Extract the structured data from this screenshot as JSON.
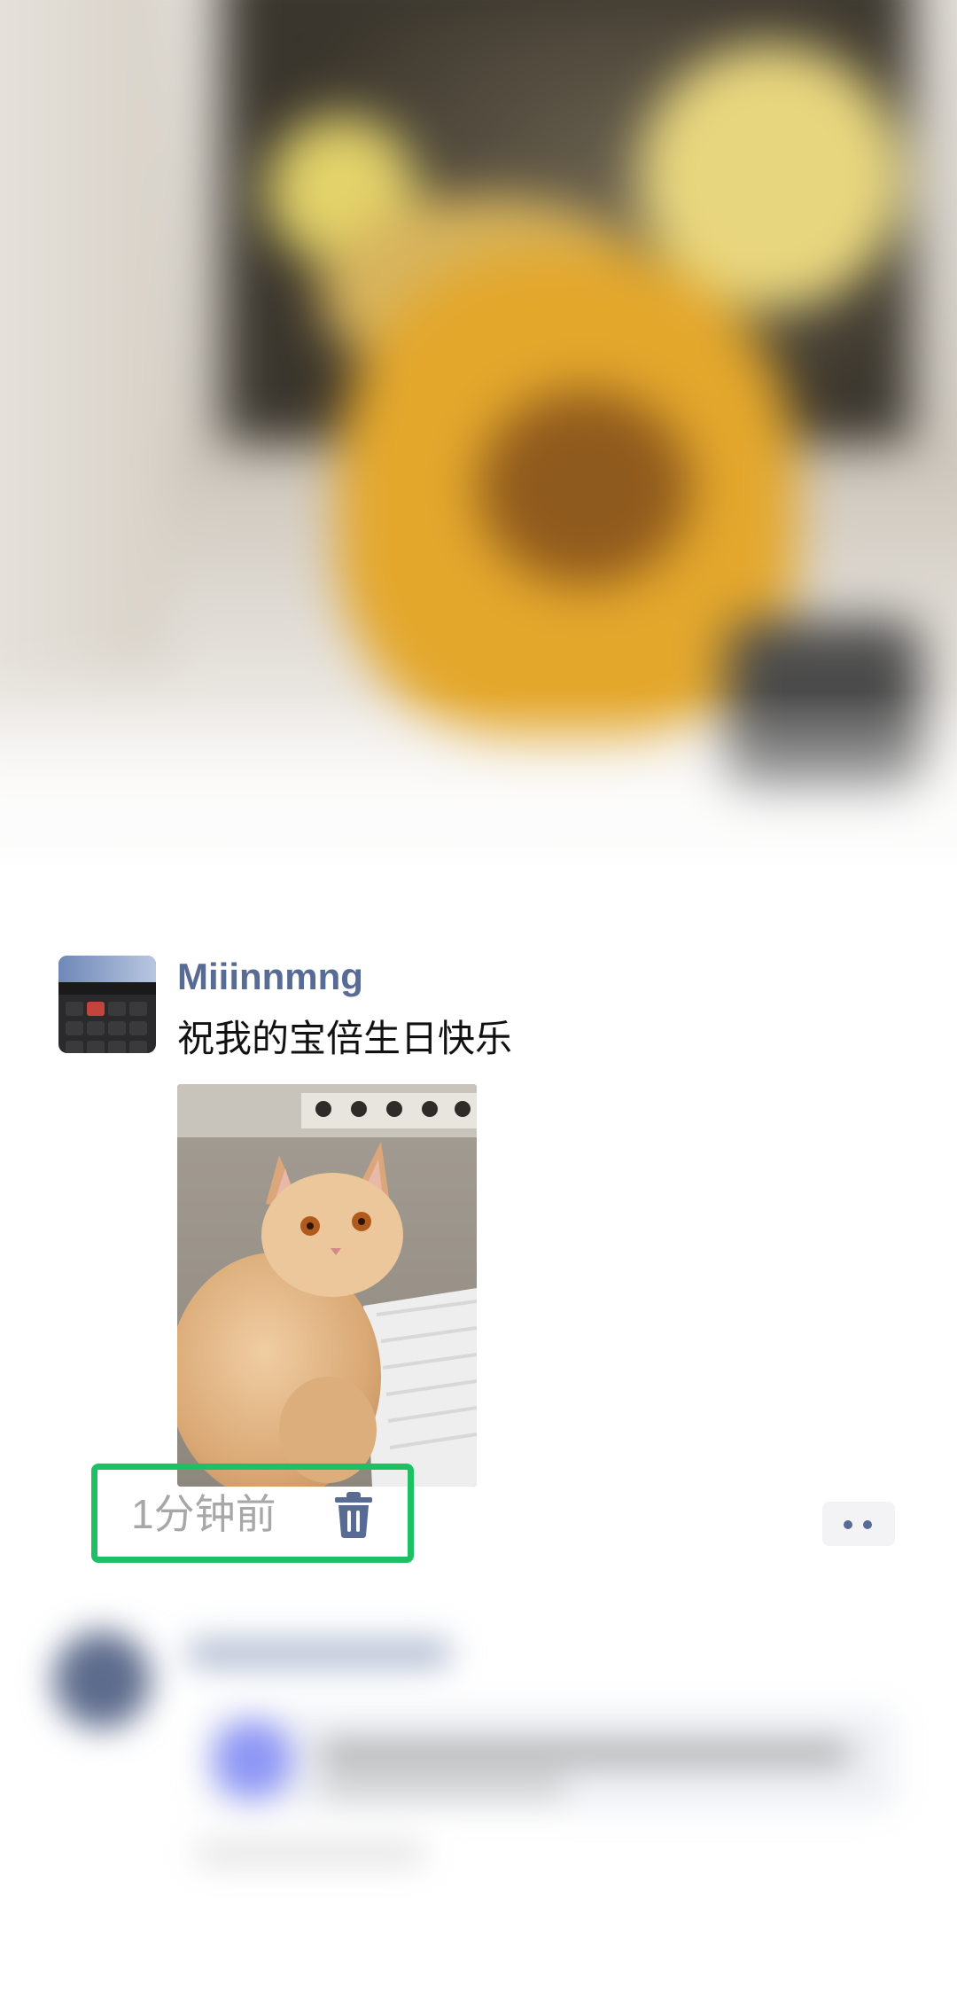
{
  "cover": {
    "icon": "blurred-cover-photo"
  },
  "post": {
    "username": "Miiinnmng",
    "text": "祝我的宝倍生日快乐",
    "photo_icon": "cat-photo",
    "timestamp": "1分钟前",
    "delete_icon": "trash-icon",
    "more_icon": "more-dots-icon"
  },
  "colors": {
    "link_blue": "#576b95",
    "highlight_green": "#1ec065",
    "timestamp_gray": "#a7a7a7"
  }
}
